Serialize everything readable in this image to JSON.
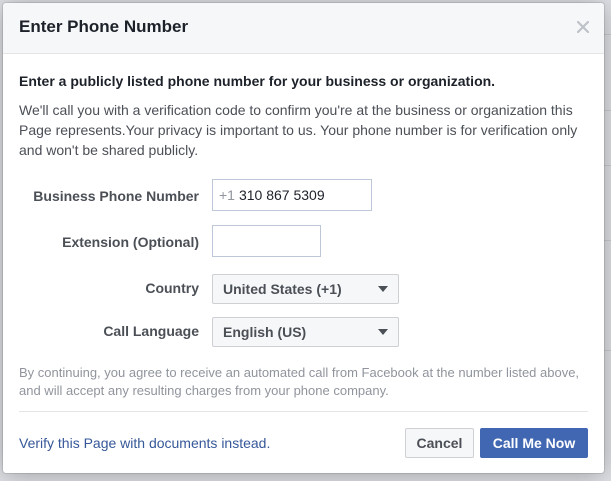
{
  "dialog": {
    "title": "Enter Phone Number",
    "close_icon": "close-icon"
  },
  "intro": {
    "heading": "Enter a publicly listed phone number for your business or organization.",
    "text": "We'll call you with a verification code to confirm you're at the business or organization this Page represents.Your privacy is important to us. Your phone number is for verification only and won't be shared publicly."
  },
  "form": {
    "phone": {
      "label": "Business Phone Number",
      "prefix": "+1",
      "value": "310 867 5309"
    },
    "extension": {
      "label": "Extension (Optional)",
      "value": ""
    },
    "country": {
      "label": "Country",
      "selected": "United States (+1)"
    },
    "language": {
      "label": "Call Language",
      "selected": "English (US)"
    }
  },
  "disclaimer": "By continuing, you agree to receive an automated call from Facebook at the number listed above, and will accept any resulting charges from your phone company.",
  "footer": {
    "link": "Verify this Page with documents instead.",
    "cancel": "Cancel",
    "primary": "Call Me Now"
  },
  "colors": {
    "primary": "#4267b2",
    "link": "#365899",
    "header_bg": "#f6f7f9"
  }
}
